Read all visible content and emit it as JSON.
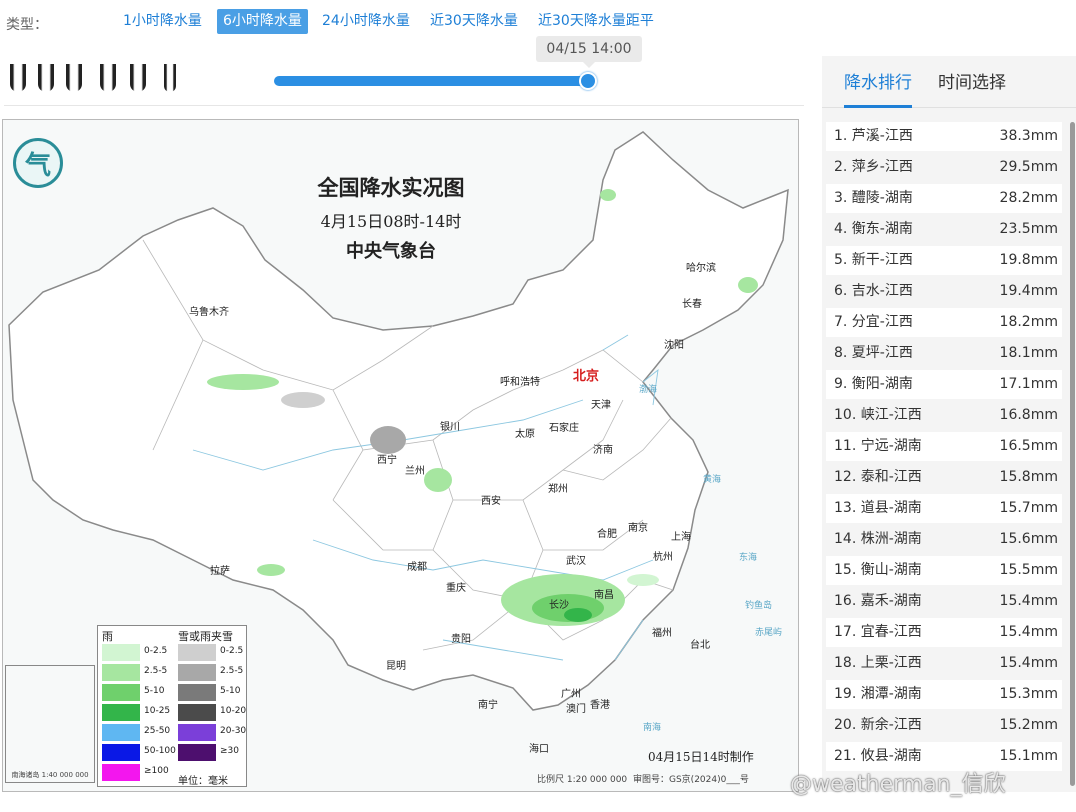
{
  "type_label": "类型：",
  "type_tabs": [
    {
      "label": "1小时降水量",
      "active": false
    },
    {
      "label": "6小时降水量",
      "active": true
    },
    {
      "label": "24小时降水量",
      "active": false
    },
    {
      "label": "近30天降水量",
      "active": false
    },
    {
      "label": "近30天降水量距平",
      "active": false
    }
  ],
  "slider": {
    "time_label": "04/15 14:00",
    "position_fraction": 1.0
  },
  "map": {
    "title": "全国降水实况图",
    "subtitle": "4月15日08时-14时",
    "agency": "中央气象台",
    "made_note": "04月15日14时制作",
    "scale_note": "比例尺 1:20 000 000",
    "approval_note": "审图号：GS京(2024)0___号",
    "inset_label": "南海诸岛 1:40 000 000",
    "capital": "北京",
    "cities": [
      "乌鲁木齐",
      "哈尔滨",
      "长春",
      "沈阳",
      "呼和浩特",
      "天津",
      "银川",
      "太原",
      "石家庄",
      "济南",
      "西宁",
      "兰州",
      "西安",
      "郑州",
      "合肥",
      "南京",
      "上海",
      "拉萨",
      "成都",
      "武汉",
      "杭州",
      "重庆",
      "长沙",
      "南昌",
      "贵阳",
      "福州",
      "台北",
      "昆明",
      "广州",
      "澳门",
      "香港",
      "南宁",
      "海口"
    ],
    "seas": [
      "渤海",
      "黄海",
      "东海",
      "南海",
      "钓鱼岛",
      "赤尾屿"
    ]
  },
  "legend": {
    "rain_header": "雨",
    "snow_header": "雪或雨夹雪",
    "unit": "单位：毫米",
    "rain": [
      {
        "label": "0-2.5",
        "color": "#d2f5d2"
      },
      {
        "label": "2.5-5",
        "color": "#a6e6a0"
      },
      {
        "label": "5-10",
        "color": "#6fd06c"
      },
      {
        "label": "10-25",
        "color": "#33b54a"
      },
      {
        "label": "25-50",
        "color": "#5fb7f2"
      },
      {
        "label": "50-100",
        "color": "#0a18e6"
      },
      {
        "label": "≥100",
        "color": "#f316ee"
      }
    ],
    "snow": [
      {
        "label": "0-2.5",
        "color": "#cfcfcf"
      },
      {
        "label": "2.5-5",
        "color": "#a8a8a8"
      },
      {
        "label": "5-10",
        "color": "#7a7a7a"
      },
      {
        "label": "10-20",
        "color": "#4b4b4b"
      },
      {
        "label": "20-30",
        "color": "#7b3fd9"
      },
      {
        "label": "≥30",
        "color": "#4d0f6e"
      }
    ]
  },
  "tabs": [
    {
      "label": "降水排行",
      "active": true
    },
    {
      "label": "时间选择",
      "active": false
    }
  ],
  "ranking": [
    {
      "name": "1. 芦溪-江西",
      "value": "38.3mm"
    },
    {
      "name": "2. 萍乡-江西",
      "value": "29.5mm"
    },
    {
      "name": "3. 醴陵-湖南",
      "value": "28.2mm"
    },
    {
      "name": "4. 衡东-湖南",
      "value": "23.5mm"
    },
    {
      "name": "5. 新干-江西",
      "value": "19.8mm"
    },
    {
      "name": "6. 吉水-江西",
      "value": "19.4mm"
    },
    {
      "name": "7. 分宜-江西",
      "value": "18.2mm"
    },
    {
      "name": "8. 夏坪-江西",
      "value": "18.1mm"
    },
    {
      "name": "9. 衡阳-湖南",
      "value": "17.1mm"
    },
    {
      "name": "10. 峡江-江西",
      "value": "16.8mm"
    },
    {
      "name": "11. 宁远-湖南",
      "value": "16.5mm"
    },
    {
      "name": "12. 泰和-江西",
      "value": "15.8mm"
    },
    {
      "name": "13. 道县-湖南",
      "value": "15.7mm"
    },
    {
      "name": "14. 株洲-湖南",
      "value": "15.6mm"
    },
    {
      "name": "15. 衡山-湖南",
      "value": "15.5mm"
    },
    {
      "name": "16. 嘉禾-湖南",
      "value": "15.4mm"
    },
    {
      "name": "17. 宜春-江西",
      "value": "15.4mm"
    },
    {
      "name": "18. 上栗-江西",
      "value": "15.4mm"
    },
    {
      "name": "19. 湘潭-湖南",
      "value": "15.3mm"
    },
    {
      "name": "20. 新余-江西",
      "value": "15.2mm"
    },
    {
      "name": "21. 攸县-湖南",
      "value": "15.1mm"
    }
  ],
  "watermark": "@weatherman_信欣"
}
